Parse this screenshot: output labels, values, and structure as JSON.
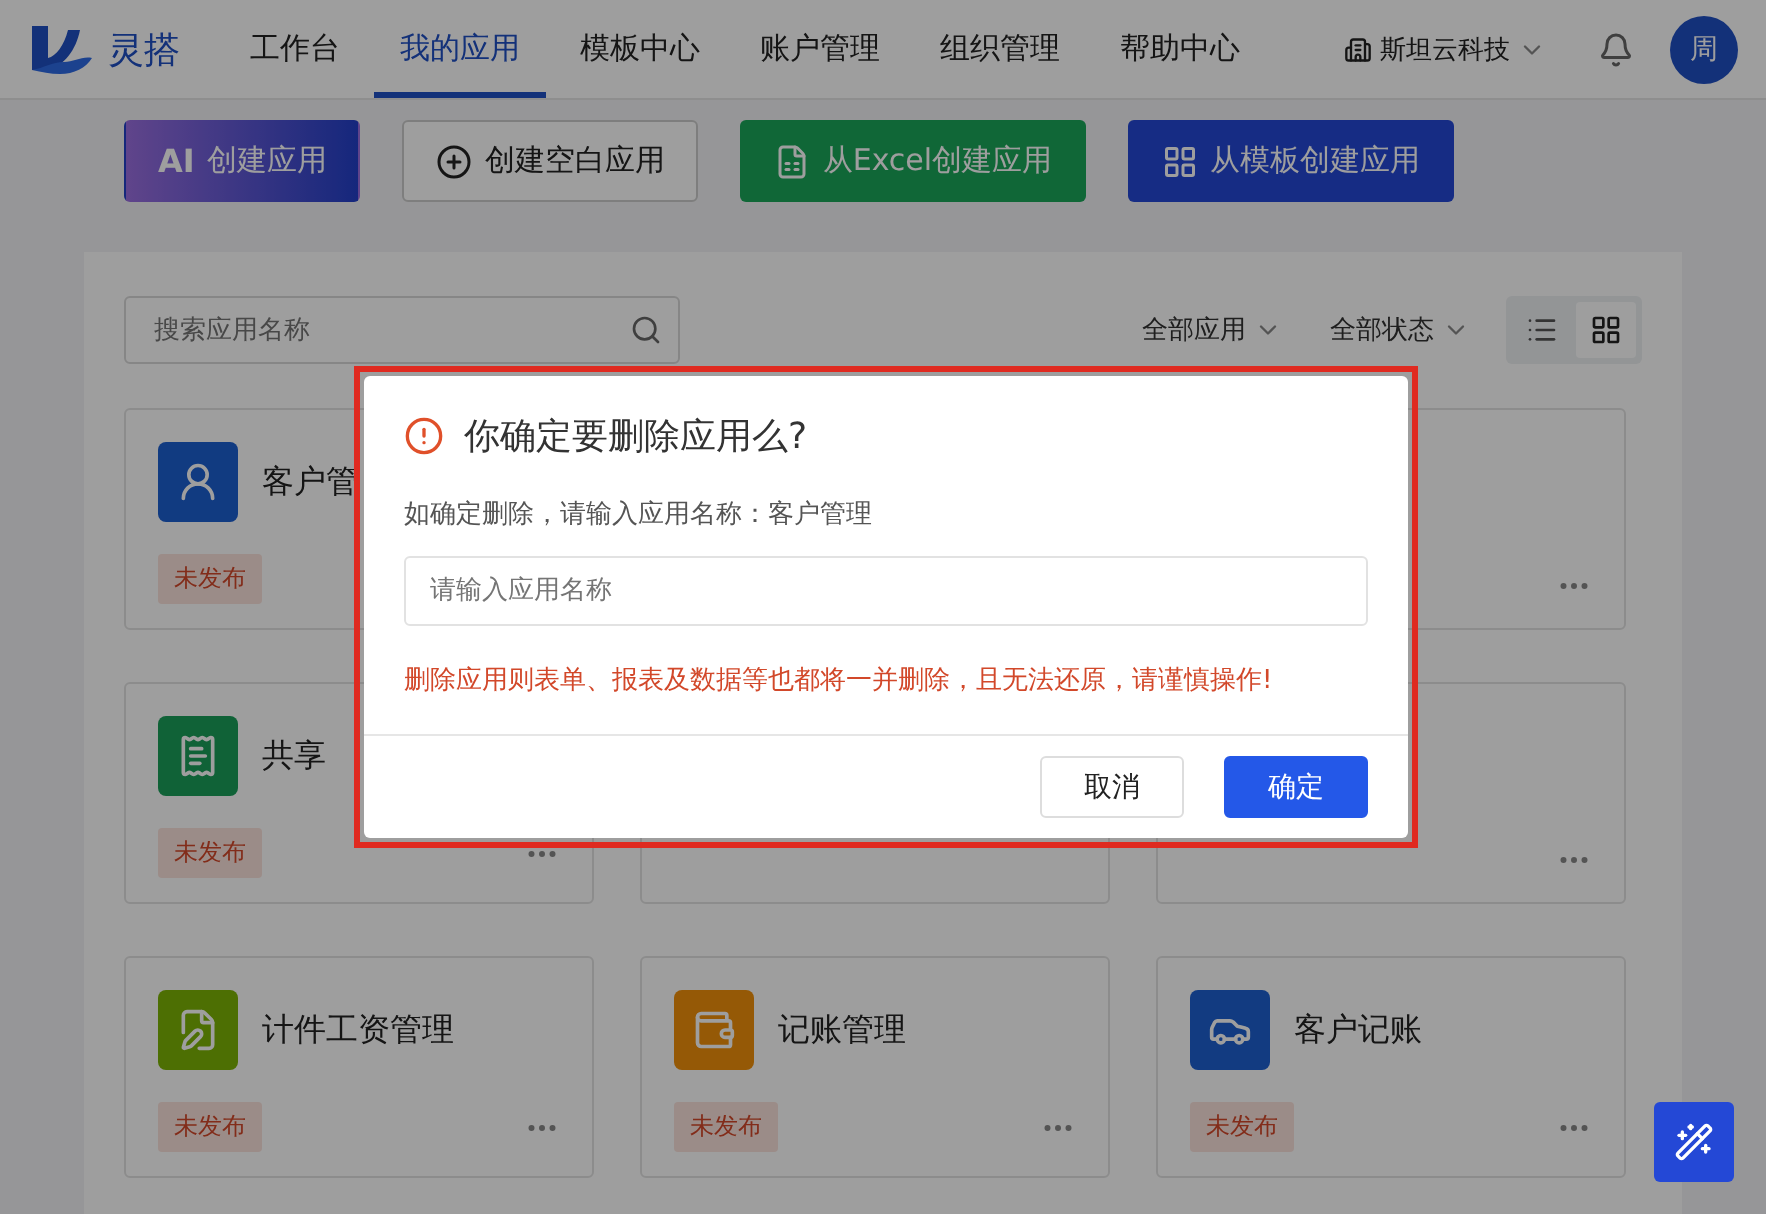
{
  "header": {
    "logo_text": "灵搭",
    "nav": [
      {
        "label": "工作台",
        "selected": false
      },
      {
        "label": "我的应用",
        "selected": true
      },
      {
        "label": "模板中心",
        "selected": false
      },
      {
        "label": "账户管理",
        "selected": false
      },
      {
        "label": "组织管理",
        "selected": false
      },
      {
        "label": "帮助中心",
        "selected": false
      }
    ],
    "org": "斯坦云科技",
    "avatar": "周"
  },
  "actions": [
    {
      "kind": "ai",
      "prefix": "AI",
      "label": "创建应用"
    },
    {
      "kind": "blank",
      "label": "创建空白应用"
    },
    {
      "kind": "excel",
      "label": "从Excel创建应用"
    },
    {
      "kind": "template",
      "label": "从模板创建应用"
    }
  ],
  "toolbar": {
    "search_placeholder": "搜索应用名称",
    "filters": [
      "全部应用",
      "全部状态"
    ],
    "views": [
      {
        "kind": "list",
        "selected": false
      },
      {
        "kind": "grid",
        "selected": true
      }
    ]
  },
  "cards": [
    {
      "kind": "person",
      "title": "客户管",
      "badge": "未发布"
    },
    {
      "kind": "hidden"
    },
    {
      "kind": "covered",
      "menu": true
    },
    {
      "kind": "receipt",
      "title": "共享",
      "badge": "未发布",
      "menu": true
    },
    {
      "kind": "covered"
    },
    {
      "kind": "covered",
      "menu": true
    },
    {
      "kind": "edit",
      "title": "计件工资管理",
      "badge": "未发布",
      "menu": true
    },
    {
      "kind": "wallet",
      "title": "记账管理",
      "badge": "未发布",
      "menu": true
    },
    {
      "kind": "car",
      "title": "客户记账",
      "badge": "未发布",
      "menu": true
    }
  ],
  "dialog": {
    "title": "你确定要删除应用么?",
    "prompt": "如确定删除，请输入应用名称：客户管理",
    "placeholder": "请输入应用名称",
    "warning": "删除应用则表单、报表及数据等也都将一并删除，且无法还原，请谨慎操作!",
    "buttons": [
      {
        "kind": "secondary",
        "label": "取消"
      },
      {
        "kind": "primary",
        "label": "确定"
      }
    ]
  }
}
